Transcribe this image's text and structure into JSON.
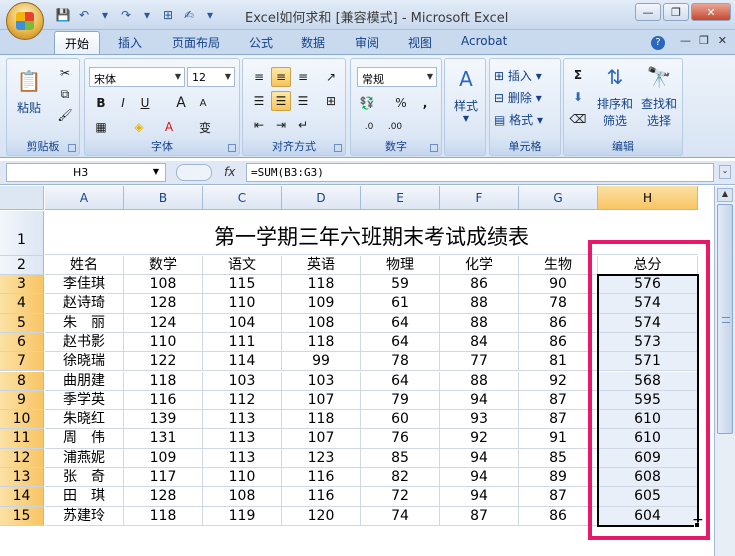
{
  "window": {
    "title": "Excel如何求和  [兼容模式] - Microsoft Excel",
    "min": "—",
    "restore": "❐",
    "close": "✕"
  },
  "qat": {
    "save": "💾",
    "undo": "↶",
    "redo": "↷"
  },
  "tabs": [
    "开始",
    "插入",
    "页面布局",
    "公式",
    "数据",
    "审阅",
    "视图",
    "Acrobat"
  ],
  "ribbon": {
    "clipboard": {
      "label": "剪贴板",
      "paste": "粘贴"
    },
    "font": {
      "label": "字体",
      "name": "宋体",
      "size": "12",
      "bold": "B",
      "italic": "I",
      "underline": "U",
      "grow": "A",
      "shrink": "A",
      "phonetic": "变"
    },
    "alignment": {
      "label": "对齐方式"
    },
    "number": {
      "label": "数字",
      "format": "常规",
      "percent": "%",
      "comma": ",",
      "inc": ".0",
      "dec": ".00"
    },
    "styles": {
      "label": "样式"
    },
    "cells": {
      "label": "单元格",
      "insert": "插入",
      "delete": "删除",
      "format": "格式"
    },
    "editing": {
      "label": "编辑",
      "sort": "排序和",
      "sort2": "筛选",
      "find": "查找和",
      "find2": "选择"
    }
  },
  "formula_bar": {
    "name_box": "H3",
    "fx": "fx",
    "formula": "=SUM(B3:G3)"
  },
  "sheet": {
    "columns": [
      "A",
      "B",
      "C",
      "D",
      "E",
      "F",
      "G",
      "H"
    ],
    "selected_column": "H",
    "title": "第一学期三年六班期末考试成绩表",
    "headers": [
      "姓名",
      "数学",
      "语文",
      "英语",
      "物理",
      "化学",
      "生物",
      "总分"
    ],
    "rows": [
      [
        "李佳琪",
        "108",
        "115",
        "118",
        "59",
        "86",
        "90",
        "576"
      ],
      [
        "赵诗琦",
        "128",
        "110",
        "109",
        "61",
        "88",
        "78",
        "574"
      ],
      [
        "朱　丽",
        "124",
        "104",
        "108",
        "64",
        "88",
        "86",
        "574"
      ],
      [
        "赵书影",
        "110",
        "111",
        "118",
        "64",
        "84",
        "86",
        "573"
      ],
      [
        "徐晓瑞",
        "122",
        "114",
        "99",
        "78",
        "77",
        "81",
        "571"
      ],
      [
        "曲朋建",
        "118",
        "103",
        "103",
        "64",
        "88",
        "92",
        "568"
      ],
      [
        "季学英",
        "116",
        "112",
        "107",
        "79",
        "94",
        "87",
        "595"
      ],
      [
        "朱晓红",
        "139",
        "113",
        "118",
        "60",
        "93",
        "87",
        "610"
      ],
      [
        "周　伟",
        "131",
        "113",
        "107",
        "76",
        "92",
        "91",
        "610"
      ],
      [
        "浦燕妮",
        "109",
        "113",
        "123",
        "85",
        "94",
        "85",
        "609"
      ],
      [
        "张　奇",
        "117",
        "110",
        "116",
        "82",
        "94",
        "89",
        "608"
      ],
      [
        "田　琪",
        "128",
        "108",
        "116",
        "72",
        "94",
        "87",
        "605"
      ],
      [
        "苏建玲",
        "118",
        "119",
        "120",
        "74",
        "87",
        "86",
        "604"
      ]
    ],
    "row_numbers": [
      "1",
      "2",
      "3",
      "4",
      "5",
      "6",
      "7",
      "8",
      "9",
      "10",
      "11",
      "12",
      "13",
      "14",
      "15"
    ],
    "highlight_color": "#e6196a"
  }
}
